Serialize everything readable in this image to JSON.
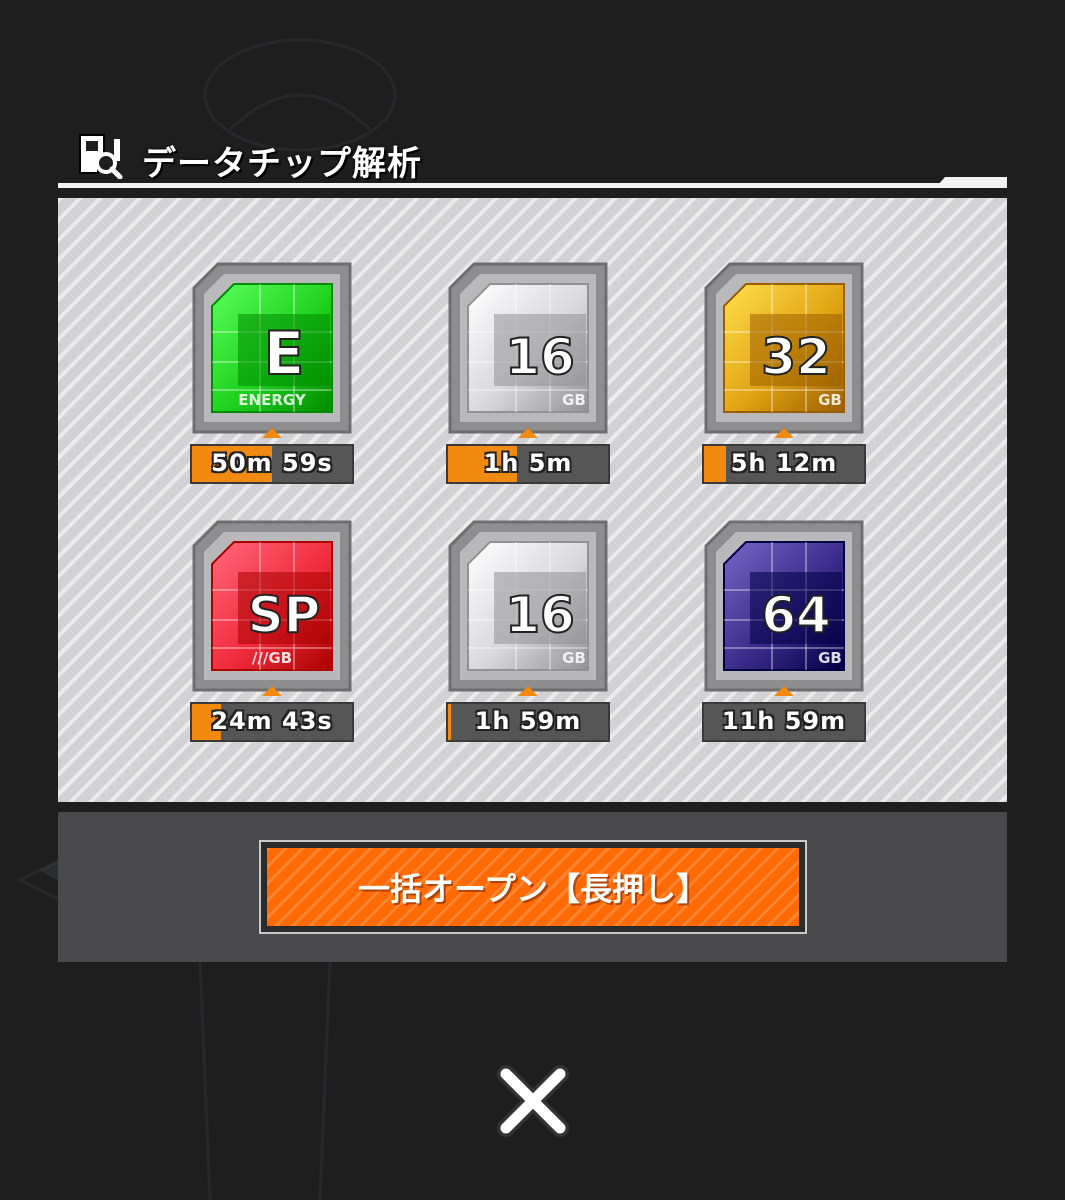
{
  "dialog": {
    "title": "データチップ解析",
    "title_icon": "data-chip-search-icon"
  },
  "chips": [
    {
      "id": "energy",
      "label": "E",
      "sublabel": "ENERGY",
      "color": "#1fd11f",
      "timer": "50m 59s",
      "progress": 0.5
    },
    {
      "id": "16gb-a",
      "label": "16",
      "sublabel": "GB",
      "color": "#d8d8dc",
      "timer": "1h 5m",
      "progress": 0.43
    },
    {
      "id": "32gb",
      "label": "32",
      "sublabel": "GB",
      "color": "#e0a412",
      "timer": "5h 12m",
      "progress": 0.14
    },
    {
      "id": "sp",
      "label": "SP",
      "sublabel": "///GB",
      "color": "#f02c3e",
      "timer": "24m 43s",
      "progress": 0.18
    },
    {
      "id": "16gb-b",
      "label": "16",
      "sublabel": "GB",
      "color": "#d8d8dc",
      "timer": "1h 59m",
      "progress": 0.02
    },
    {
      "id": "64gb",
      "label": "64",
      "sublabel": "GB",
      "color": "#3a2a8a",
      "timer": "11h 59m",
      "progress": 0.0
    }
  ],
  "actions": {
    "open_all_label": "一括オープン【長押し】",
    "close_icon": "close-icon"
  },
  "colors": {
    "accent_orange": "#ff6a05",
    "panel_bg": "#d2d2d4",
    "timer_bg": "#565657"
  }
}
